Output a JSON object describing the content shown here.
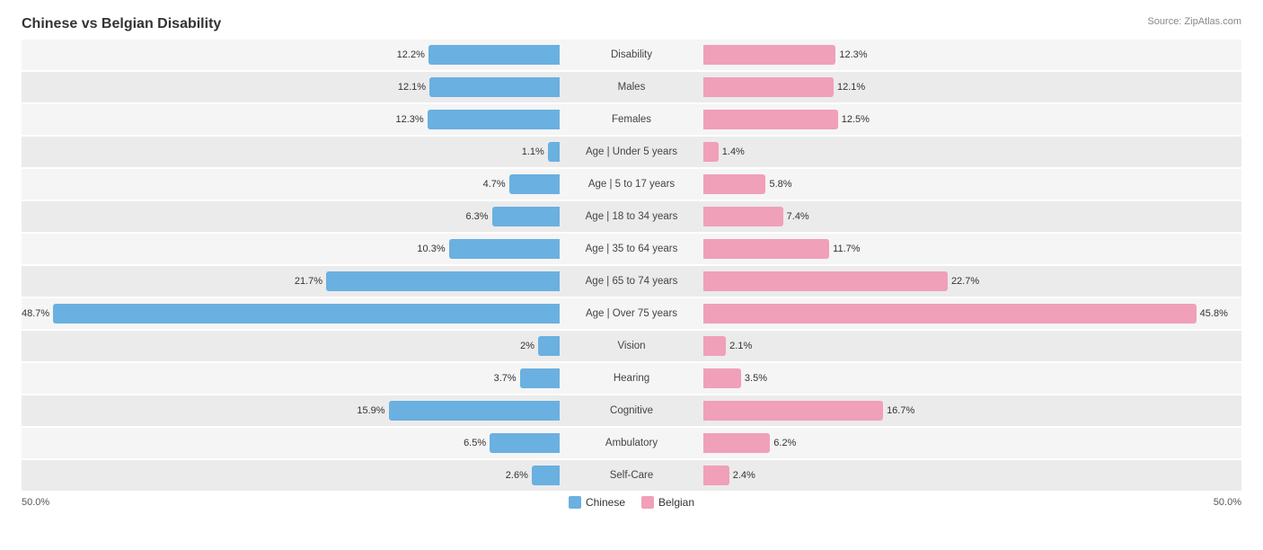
{
  "title": "Chinese vs Belgian Disability",
  "source": "Source: ZipAtlas.com",
  "scale_left": "50.0%",
  "scale_right": "50.0%",
  "legend": {
    "chinese_label": "Chinese",
    "belgian_label": "Belgian"
  },
  "rows": [
    {
      "label": "Disability",
      "chinese": 12.2,
      "belgian": 12.3,
      "maxScale": 50
    },
    {
      "label": "Males",
      "chinese": 12.1,
      "belgian": 12.1,
      "maxScale": 50
    },
    {
      "label": "Females",
      "chinese": 12.3,
      "belgian": 12.5,
      "maxScale": 50
    },
    {
      "label": "Age | Under 5 years",
      "chinese": 1.1,
      "belgian": 1.4,
      "maxScale": 50
    },
    {
      "label": "Age | 5 to 17 years",
      "chinese": 4.7,
      "belgian": 5.8,
      "maxScale": 50
    },
    {
      "label": "Age | 18 to 34 years",
      "chinese": 6.3,
      "belgian": 7.4,
      "maxScale": 50
    },
    {
      "label": "Age | 35 to 64 years",
      "chinese": 10.3,
      "belgian": 11.7,
      "maxScale": 50
    },
    {
      "label": "Age | 65 to 74 years",
      "chinese": 21.7,
      "belgian": 22.7,
      "maxScale": 50
    },
    {
      "label": "Age | Over 75 years",
      "chinese": 48.7,
      "belgian": 45.8,
      "maxScale": 50
    },
    {
      "label": "Vision",
      "chinese": 2.0,
      "belgian": 2.1,
      "maxScale": 50
    },
    {
      "label": "Hearing",
      "chinese": 3.7,
      "belgian": 3.5,
      "maxScale": 50
    },
    {
      "label": "Cognitive",
      "chinese": 15.9,
      "belgian": 16.7,
      "maxScale": 50
    },
    {
      "label": "Ambulatory",
      "chinese": 6.5,
      "belgian": 6.2,
      "maxScale": 50
    },
    {
      "label": "Self-Care",
      "chinese": 2.6,
      "belgian": 2.4,
      "maxScale": 50
    }
  ]
}
